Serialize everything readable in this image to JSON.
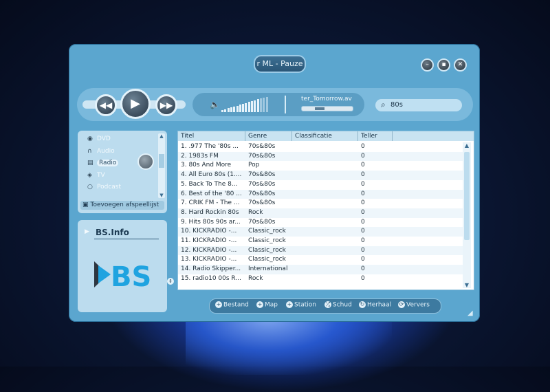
{
  "window": {
    "title": "r ML - Pauze"
  },
  "window_controls": {
    "minimize": "–",
    "maximize": "▪",
    "close": "✕"
  },
  "transport": {
    "track_name": "ter_Tomorrow.av",
    "volume_level": 0.75,
    "progress": 0.35
  },
  "search": {
    "value": "80s"
  },
  "sidebar": {
    "items": [
      {
        "label": "DVD",
        "icon": "disc-icon"
      },
      {
        "label": "Audio",
        "icon": "headphones-icon"
      },
      {
        "label": "Radio",
        "icon": "radio-icon"
      },
      {
        "label": "TV",
        "icon": "tv-icon"
      },
      {
        "label": "Podcast",
        "icon": "podcast-icon"
      }
    ],
    "add_to_playlist": "Toevoegen afspeellijst"
  },
  "info": {
    "title": "BS.Info",
    "logo_text": "BS"
  },
  "table": {
    "headers": [
      "Titel",
      "Genre",
      "Classificatie",
      "Teller"
    ],
    "rows": [
      [
        "1. .977 The '80s ...",
        "70s&80s",
        "",
        "0"
      ],
      [
        "2. 1983s FM",
        "70s&80s",
        "",
        "0"
      ],
      [
        "3. 80s And More",
        "Pop",
        "",
        "0"
      ],
      [
        "4. All Euro 80s (1....",
        "70s&80s",
        "",
        "0"
      ],
      [
        "5. Back To The 8...",
        "70s&80s",
        "",
        "0"
      ],
      [
        "6. Best of the '80 ...",
        "70s&80s",
        "",
        "0"
      ],
      [
        "7. CRIK FM - The ...",
        "70s&80s",
        "",
        "0"
      ],
      [
        "8. Hard Rockin 80s",
        "Rock",
        "",
        "0"
      ],
      [
        "9. Hits 80s 90s ar...",
        "70s&80s",
        "",
        "0"
      ],
      [
        "10. KICKRADIO -...",
        "Classic_rock",
        "",
        "0"
      ],
      [
        "11. KICKRADIO -...",
        "Classic_rock",
        "",
        "0"
      ],
      [
        "12. KICKRADIO -...",
        "Classic_rock",
        "",
        "0"
      ],
      [
        "13. KICKRADIO -...",
        "Classic_rock",
        "",
        "0"
      ],
      [
        "14. Radio Skipper...",
        "International",
        "",
        "0"
      ],
      [
        "15. radio10 00s R...",
        "Rock",
        "",
        "0"
      ]
    ]
  },
  "bottom_bar": {
    "buttons": [
      {
        "label": "Bestand",
        "icon": "plus-icon"
      },
      {
        "label": "Map",
        "icon": "plus-icon"
      },
      {
        "label": "Station",
        "icon": "plus-icon"
      },
      {
        "label": "Schud",
        "icon": "shuffle-icon"
      },
      {
        "label": "Herhaal",
        "icon": "repeat-icon"
      },
      {
        "label": "Ververs",
        "icon": "refresh-icon"
      }
    ]
  },
  "colors": {
    "window": "#5ba6cf",
    "panel": "#bcdcee",
    "accent": "#1fa3e0"
  }
}
